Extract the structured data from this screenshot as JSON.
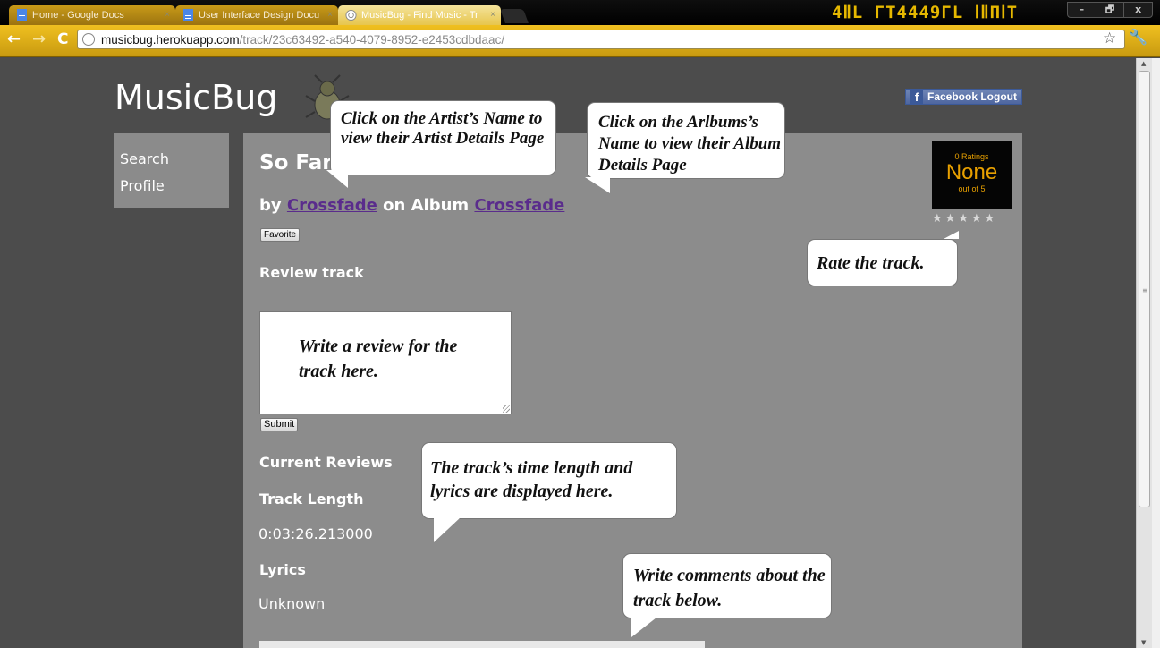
{
  "browser": {
    "tabs": [
      {
        "label": "Home - Google Docs",
        "close": "×"
      },
      {
        "label": "User Interface Design Docu",
        "close": "×"
      },
      {
        "label": "MusicBug - Find Music - Tr",
        "close": "×"
      }
    ],
    "deco_text": "4ⅡL ΓΤ4449ΓL ⅠⅡΠⅠΤ",
    "window_buttons": [
      "–",
      "🗗",
      "x"
    ],
    "nav": {
      "back": "←",
      "forward": "→",
      "reload": "C"
    },
    "url_host": "musicbug.herokuapp.com",
    "url_path": "/track/23c63492-a540-4079-8952-e2453cdbdaac/",
    "star": "☆",
    "wrench": "🔧"
  },
  "site": {
    "brand": "MusicBug",
    "facebook_logout": "Facebook Logout",
    "facebook_f": "f"
  },
  "sidebar": {
    "items": [
      {
        "label": "Search"
      },
      {
        "label": "Profile"
      }
    ]
  },
  "track": {
    "title": "So Far",
    "by_label": "by",
    "artist": "Crossfade",
    "on_album_label": "on Album",
    "album": "Crossfade",
    "favorite_button": "Favorite",
    "review_heading": "Review track",
    "submit_button": "Submit",
    "current_reviews_heading": "Current Reviews",
    "length_heading": "Track Length",
    "length_value": "0:03:26.213000",
    "lyrics_heading": "Lyrics",
    "lyrics_value": "Unknown"
  },
  "rating": {
    "count_text": "0 Ratings",
    "value": "None",
    "out_of": "out of 5",
    "stars": "★★★★★"
  },
  "callouts": {
    "artist": "Click on the Artist’s Name to view their Artist Details Page",
    "album": "Click on the Arlbums’s Name to view their Album Details Page",
    "rate": "Rate the track.",
    "review": "Write a review for the track here.",
    "length_lyrics": "The track’s time length and lyrics are displayed here.",
    "comments": "Write comments about the track below."
  },
  "colors": {
    "chrome_gold": "#e8b818",
    "page_bg": "#4c4c4c",
    "panel_bg": "#8c8c8c",
    "link": "#5a2c8c",
    "rating_gold": "#e8a000"
  }
}
